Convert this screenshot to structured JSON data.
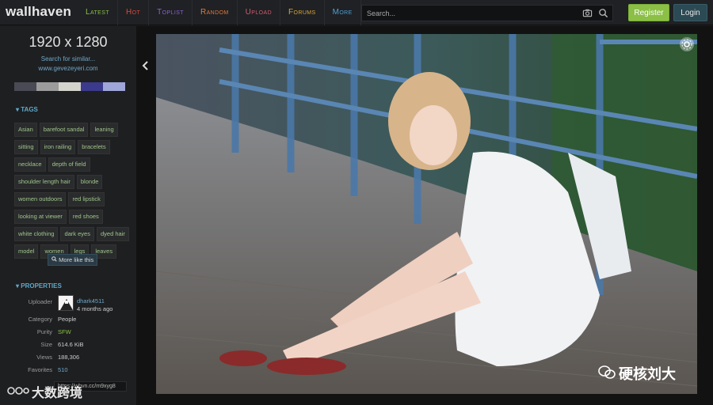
{
  "app": {
    "logo_main": "wall",
    "logo_sub": "haven"
  },
  "nav": [
    {
      "label": "Latest",
      "color": "#8bbf46"
    },
    {
      "label": "Hot",
      "color": "#e0493b"
    },
    {
      "label": "Toplist",
      "color": "#8e5fd1"
    },
    {
      "label": "Random",
      "color": "#e07a3a"
    },
    {
      "label": "Upload",
      "color": "#d05b71"
    },
    {
      "label": "Forums",
      "color": "#d9a63b"
    },
    {
      "label": "More",
      "color": "#4f9fd3"
    }
  ],
  "search": {
    "placeholder": "Search..."
  },
  "auth": {
    "register": "Register",
    "login": "Login"
  },
  "sidebar": {
    "resolution": "1920 x 1280",
    "similar": "Search for similar...",
    "site": "www.gevezeyeri.com",
    "palette": [
      "#4a4a55",
      "#9c9c9c",
      "#d4d3cc",
      "#3b3a8c",
      "#9ea6da"
    ],
    "tags_heading": "TAGS",
    "tags": [
      "Asian",
      "barefoot sandal",
      "leaning",
      "sitting",
      "iron railing",
      "bracelets",
      "necklace",
      "depth of field",
      "shoulder length hair",
      "blonde",
      "women outdoors",
      "red lipstick",
      "looking at viewer",
      "red shoes",
      "white clothing",
      "dark eyes",
      "dyed hair",
      "model",
      "women",
      "legs",
      "leaves"
    ],
    "more_tags": "More like this",
    "properties_heading": "PROPERTIES",
    "uploader_label": "Uploader",
    "uploader_name": "dhark4511",
    "uploader_ago": "4 months ago",
    "category_label": "Category",
    "category_value": "People",
    "purity_label": "Purity",
    "purity_value": "SFW",
    "size_label": "Size",
    "size_value": "614.6 KiB",
    "views_label": "Views",
    "views_value": "188,306",
    "favorites_label": "Favorites",
    "favorites_value": "510",
    "short_url": "https://whvn.cc/m9xyg8"
  },
  "watermarks": {
    "right": "硬核刘大",
    "left": "大数跨境"
  },
  "colors": {
    "accent_green": "#8bbf46",
    "tag_text": "#9ec589",
    "link_blue": "#6fa8c9",
    "purity_green": "#8bbf46"
  }
}
